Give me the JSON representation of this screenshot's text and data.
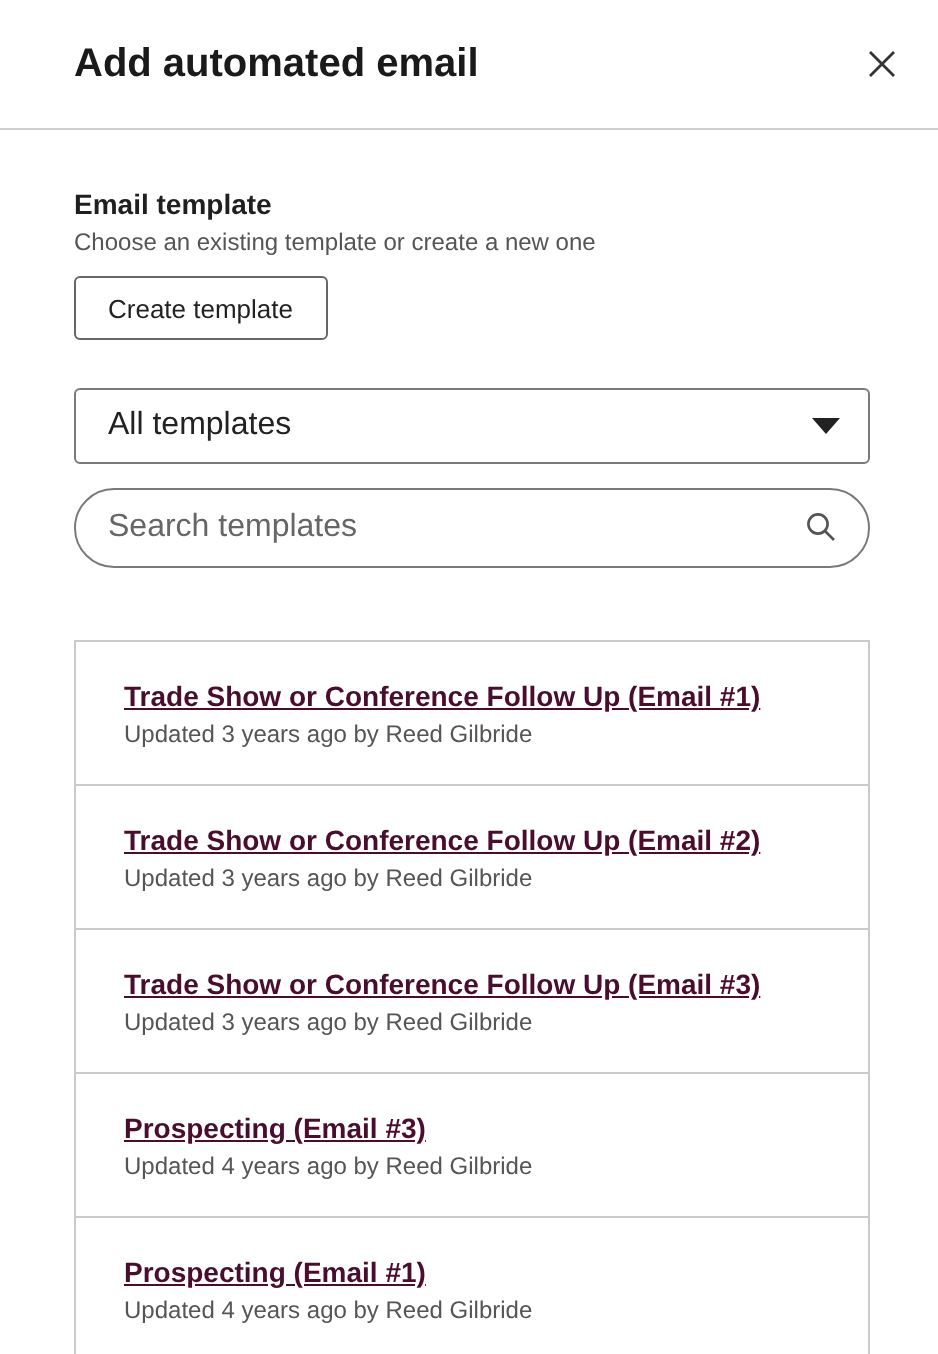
{
  "dialog": {
    "title": "Add automated email"
  },
  "section": {
    "heading": "Email template",
    "help": "Choose an existing template or create a new one",
    "button": "Create template"
  },
  "filter": {
    "value": "All templates"
  },
  "search": {
    "placeholder": "Search templates"
  },
  "templates": [
    {
      "name": "Trade Show or Conference Follow Up (Email #1)",
      "meta": "Updated 3 years ago by Reed Gilbride"
    },
    {
      "name": "Trade Show or Conference Follow Up (Email #2)",
      "meta": "Updated 3 years ago by Reed Gilbride"
    },
    {
      "name": "Trade Show or Conference Follow Up (Email #3)",
      "meta": "Updated 3 years ago by Reed Gilbride"
    },
    {
      "name": "Prospecting (Email #3)",
      "meta": "Updated 4 years ago by Reed Gilbride"
    },
    {
      "name": "Prospecting (Email #1)",
      "meta": "Updated 4 years ago by Reed Gilbride"
    }
  ]
}
